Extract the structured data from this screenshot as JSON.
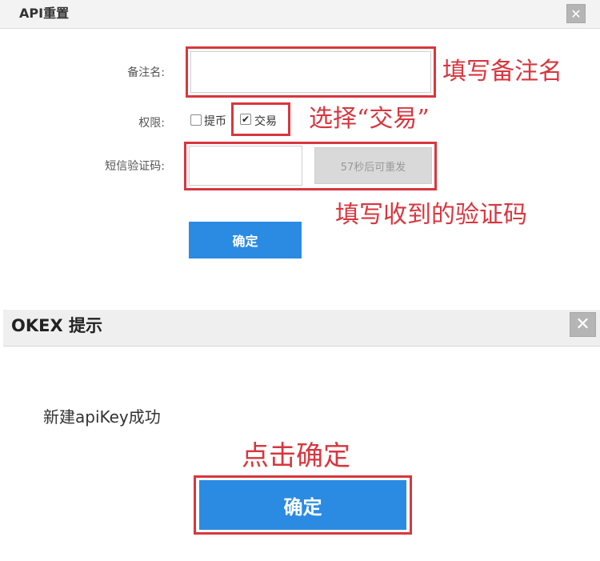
{
  "dialog1": {
    "title": "API重置",
    "close_icon": "close-icon",
    "remark_label": "备注名:",
    "remark_value": "",
    "permission_label": "权限:",
    "perm_withdraw_label": "提币",
    "perm_withdraw_checked": false,
    "perm_trade_label": "交易",
    "perm_trade_checked": true,
    "sms_label": "短信验证码:",
    "sms_value": "",
    "resend_label": "57秒后可重发",
    "confirm_label": "确定"
  },
  "annotations": {
    "fill_remark": "填写备注名",
    "choose_trade": "选择“交易”",
    "fill_code": "填写收到的验证码",
    "click_confirm": "点击确定"
  },
  "dialog2": {
    "title": "OKEX 提示",
    "close_icon": "close-icon",
    "message": "新建apiKey成功",
    "confirm_label": "确定"
  },
  "colors": {
    "highlight_red": "#d9363e",
    "primary_blue": "#2b8be3",
    "disabled_gray": "#d9d9d9"
  }
}
